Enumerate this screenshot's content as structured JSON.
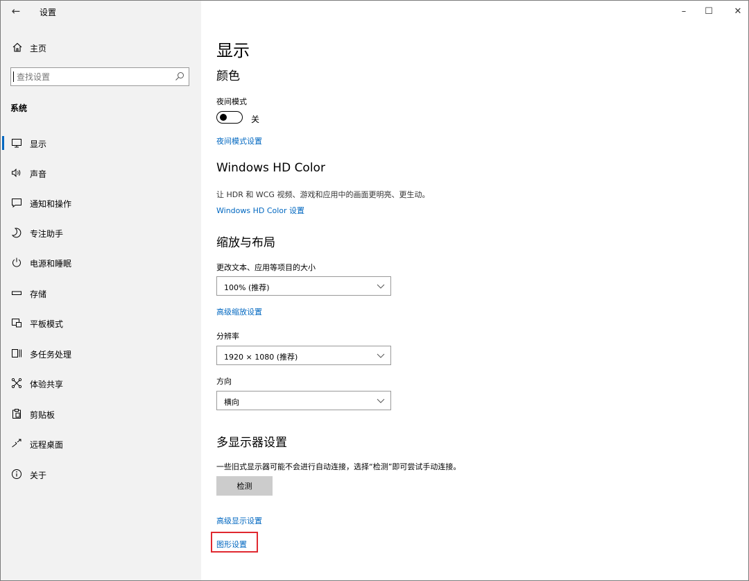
{
  "app": {
    "title": "设置",
    "back_icon": "back-arrow-icon"
  },
  "window_controls": {
    "minimize": "–",
    "maximize": "☐",
    "close": "✕"
  },
  "sidebar": {
    "home_label": "主页",
    "search_placeholder": "查找设置",
    "section_title": "系统",
    "items": [
      {
        "label": "显示",
        "icon": "monitor-icon",
        "active": true
      },
      {
        "label": "声音",
        "icon": "speaker-icon"
      },
      {
        "label": "通知和操作",
        "icon": "notification-icon"
      },
      {
        "label": "专注助手",
        "icon": "moon-icon"
      },
      {
        "label": "电源和睡眠",
        "icon": "power-icon"
      },
      {
        "label": "存储",
        "icon": "storage-icon"
      },
      {
        "label": "平板模式",
        "icon": "tablet-icon"
      },
      {
        "label": "多任务处理",
        "icon": "multitask-icon"
      },
      {
        "label": "体验共享",
        "icon": "share-icon"
      },
      {
        "label": "剪贴板",
        "icon": "clipboard-icon"
      },
      {
        "label": "远程桌面",
        "icon": "remote-desktop-icon"
      },
      {
        "label": "关于",
        "icon": "info-icon"
      }
    ]
  },
  "main": {
    "title": "显示",
    "color_section": {
      "heading": "颜色",
      "night_mode_label": "夜间模式",
      "night_mode_state": "关",
      "night_mode_settings_link": "夜间模式设置"
    },
    "hdr_section": {
      "heading": "Windows HD Color",
      "description": "让 HDR 和 WCG 视频、游戏和应用中的画面更明亮、更生动。",
      "settings_link": "Windows HD Color 设置"
    },
    "scale_section": {
      "heading": "缩放与布局",
      "scale_label": "更改文本、应用等项目的大小",
      "scale_value": "100% (推荐)",
      "advanced_scale_link": "高级缩放设置",
      "resolution_label": "分辨率",
      "resolution_value": "1920 × 1080 (推荐)",
      "orientation_label": "方向",
      "orientation_value": "横向"
    },
    "multi_display_section": {
      "heading": "多显示器设置",
      "description": "一些旧式显示器可能不会进行自动连接，选择“检测”即可尝试手动连接。",
      "detect_button": "检测",
      "advanced_display_link": "高级显示设置",
      "graphics_settings_link": "图形设置"
    }
  },
  "colors": {
    "accent": "#0067c0",
    "sidebar_bg": "#f2f2f2",
    "highlight": "#e0282f"
  }
}
